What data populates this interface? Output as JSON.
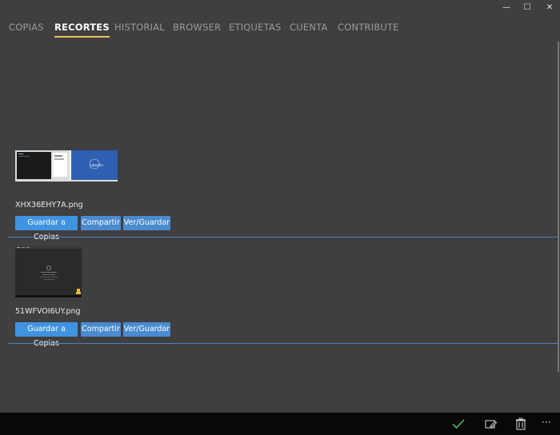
{
  "window": {
    "minimize_glyph": "—",
    "maximize_glyph": "☐",
    "close_glyph": "✕"
  },
  "tabs": [
    {
      "label": "COPIAS",
      "active": false
    },
    {
      "label": "RECORTES",
      "active": true
    },
    {
      "label": "HISTORIAL",
      "active": false
    },
    {
      "label": "BROWSER",
      "active": false
    },
    {
      "label": "ETIQUETAS",
      "active": false
    },
    {
      "label": "CUENTA",
      "active": false
    },
    {
      "label": "CONTRIBUTE",
      "active": false
    }
  ],
  "clips": [
    {
      "filename": "XHX36EHY7A.png",
      "thumbnail_label": "ubuntu",
      "buttons": {
        "save": "Guardar a Copias",
        "share": "Compartir",
        "view": "Ver/Guardar"
      }
    },
    {
      "filename": "51WFVOI6UY.png",
      "buttons": {
        "save": "Guardar a Copias",
        "share": "Compartir",
        "view": "Ver/Guardar"
      }
    }
  ],
  "bottombar": {
    "icons": [
      "check-icon",
      "edit-select-icon",
      "trash-icon",
      "more-icon"
    ],
    "more_glyph": "···"
  },
  "colors": {
    "accent_tab": "#e8c15a",
    "button_blue": "#4a8bd0",
    "button_primary": "#3f93e0",
    "check_green": "#4fc35a"
  }
}
